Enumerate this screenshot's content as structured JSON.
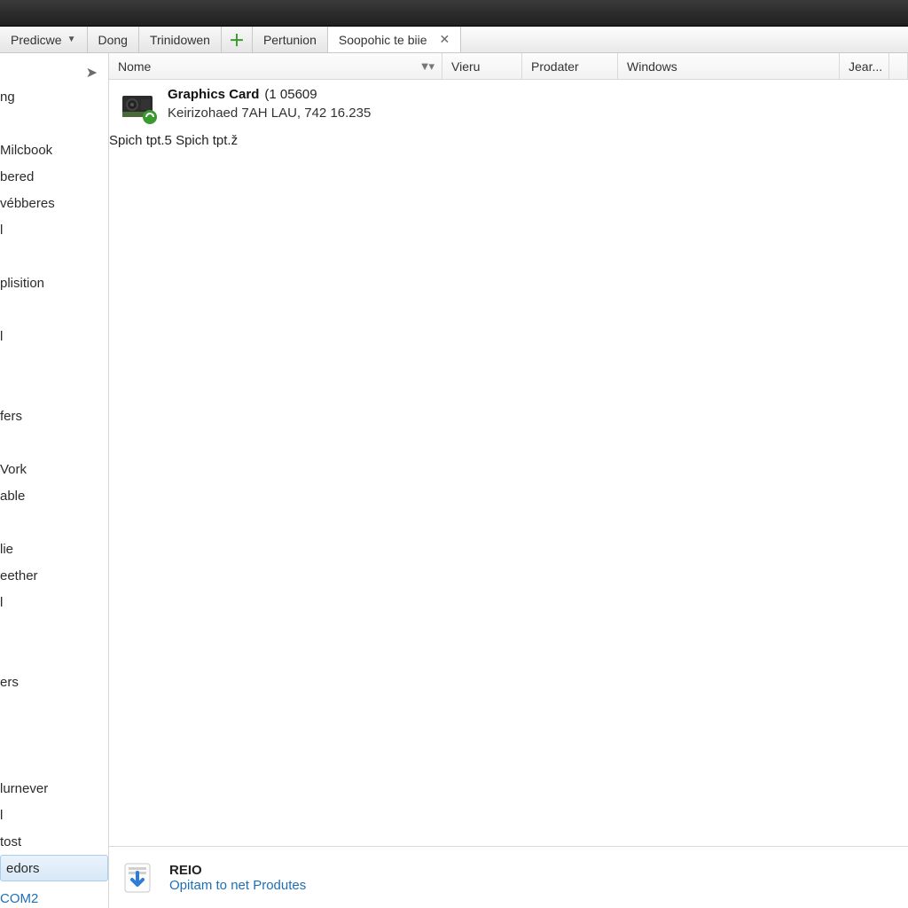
{
  "tabs": [
    {
      "label": "Predicwe",
      "has_dropdown": true
    },
    {
      "label": "Dong"
    },
    {
      "label": "Trinidowen"
    },
    {
      "label": "Pertunion"
    },
    {
      "label": "Soopohic te biie",
      "active": true,
      "closable": true
    }
  ],
  "sidebar": {
    "items": [
      "ng",
      "",
      "Milcbook",
      "bered",
      "vébberes",
      "l",
      "",
      "plisition",
      "",
      "l",
      "",
      "",
      "fers",
      "",
      "Vork",
      "able",
      "",
      "lie",
      "eether",
      "l",
      "",
      "",
      "ers",
      "",
      "",
      "",
      "lurnever",
      "l",
      "tost"
    ],
    "selected": "edors",
    "link": "COM2"
  },
  "columns": {
    "name": "Nome",
    "vieru": "Vieru",
    "prodater": "Prodater",
    "windows": "Windows",
    "jear": "Jear..."
  },
  "rows": [
    {
      "icon": "gpu-card-icon",
      "badge": "refresh-badge",
      "name_bold": "Graphics Card",
      "name_suffix": "(1 05609",
      "sub": "Keirizohaed 7AH LAU, 742 16.235",
      "vieru_top": "Spich tpt.5",
      "vieru_bot": "Spich tpt.ž"
    }
  ],
  "bottom": {
    "icon": "download-arrow-icon",
    "title": "REIO",
    "sub": "Opitam to net Produtes"
  }
}
